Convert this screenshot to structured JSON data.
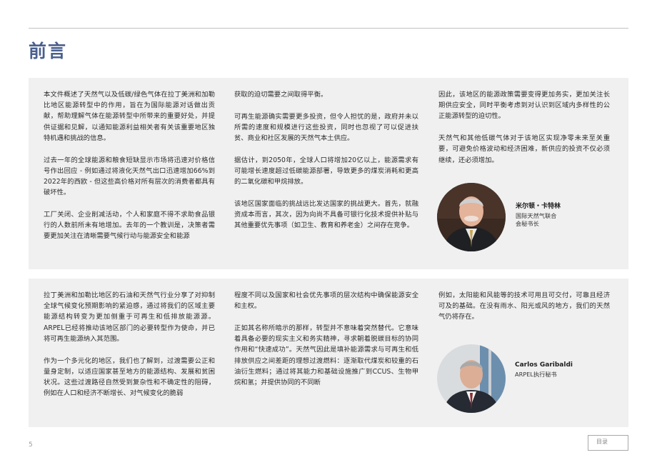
{
  "page": {
    "title": "前言",
    "page_number": "5",
    "toc_label": "目录"
  },
  "section1": {
    "col1": [
      "本文件概述了天然气以及低碳/绿色气体在拉丁美洲和加勒比地区能源转型中的作用，旨在为国际能源对话做出贡献，帮助理解气体在能源转型中所带来的重要好处，并提供证据和见解，以通知能源利益相关者有关该重要地区独特机遇和挑战的信息。",
      "过去一年的全球能源和粮食短缺显示市场将迅速对价格信号作出回应 - 例如通过将液化天然气出口迅速增加66%到2022年的西欧 - 但这些高价格对所有层次的消费者都具有破坏性。",
      "工厂关闭、企业削减活动，个人和家庭不得不求助食品银行的人数前所未有地增加。去年的一个教训是，决策者需要更加关注在清晰需要气候行动与能源安全和能源"
    ],
    "col2": [
      "获取的迫切需要之间取得平衡。",
      "可再生能源确实需要更多投资，但令人担忧的是，政府并未以所需的速度和规模进行这些投资，同时也忽视了可以促进扶贫、商业和社区发展的天然气本土供应。",
      "据估计，到2050年，全球人口将增加20亿以上，能源需求有可能增长速度超过低碳能源部署，导致更多的煤炭消耗和更高的二氧化碳和甲烷排放。",
      "该地区国家面临的挑战远比发达国家的挑战更大。首先，就融资成本而言，其次，因为向尚不具备可银行化技术提供补贴与其他重要优先事项（如卫生、教育和养老金）之间存在竞争。"
    ],
    "col3": [
      "因此，该地区的能源政策需要变得更加务实，更加关注长期供应安全，同时平衡考虑到对认识到区域内多样性的公正能源转型的迫切性。",
      "天然气和其他低碳气体对于该地区实现净零未来至关重要，可避免价格波动和经济困难，新供应的投资不仅必须继续，还必须增加。"
    ],
    "person": {
      "name": "米尔顿・卡特林",
      "org": "国际天然气联合",
      "role": "会秘书长"
    }
  },
  "section2": {
    "col1": [
      "拉丁美洲和加勒比地区的石油和天然气行业分享了对抑制全球气候变化预期影响的紧迫感，通过将我们的区域主要能源结构转变为更加侧重于可再生和低排放能源源。ARPEL已经将推动该地区部门的必要转型作为使命，并已将可再生能源纳入其范围。",
      "作为一个多元化的地区，我们也了解到，过渡需要公正和量身定制，以适应国家甚至地方的能源结构、发展和贫困状况。这些过渡路径自然受到复杂性和不确定性的阻碍，例如在人口和经济不断增长、对气候变化的脆弱"
    ],
    "col2": [
      "程度不同以及国家和社会优先事项的层次结构中确保能源安全和主权。",
      "正如其名称所暗示的那样，转型并不意味着突然替代。它意味着具备必要的现实主义和务实精神，寻求朝着脱碳目标的协同作用和“快速成功”。天然气因此是填补能源需求与可再生和低排放供应之间差距的理想过渡燃料：逐渐取代煤炭和较重的石油衍生燃料；通过将其能力和基础设施推广到CCUS、生物甲烷和氢；并提供协同的不同断"
    ],
    "col3": [
      "例如，太阳能和风能等的技术可用且可交付，可靠且经济可及的基础。在没有雨水、阳光或风的地方，我们的天然气仍将存在。"
    ],
    "person": {
      "name": "Carlos Garibaldi",
      "org": "ARPEL执行秘书"
    }
  },
  "colors": {
    "title": "#4a5f8f",
    "panel": "#f0f0f0",
    "rule": "#bfc3c6"
  }
}
